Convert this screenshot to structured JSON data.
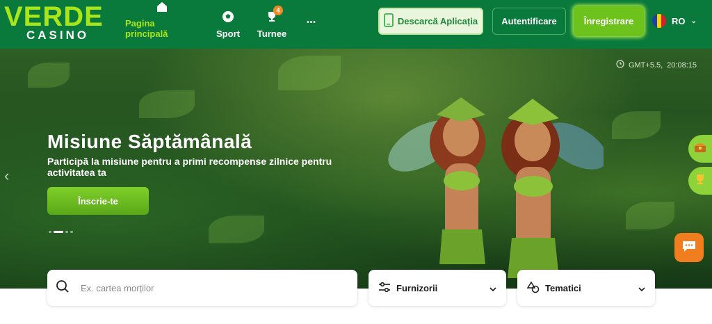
{
  "brand": {
    "logo_top": "VERDE",
    "logo_bottom": "CASINO",
    "accent": "#a8e61a",
    "header_bg": "#0a7a3c",
    "cta_green": "#6ec21c",
    "chat_orange": "#f07d1e"
  },
  "nav": [
    {
      "label": "Pagina principală",
      "icon": "home-icon",
      "active": true
    },
    {
      "label": "Sport",
      "icon": "soccer-ball-icon"
    },
    {
      "label": "Turnee",
      "icon": "trophy-icon",
      "badge": "4"
    },
    {
      "label": "•••",
      "icon": "more-icon"
    }
  ],
  "header_actions": {
    "app_label": "Descarcă Aplicația",
    "login_label": "Autentificare",
    "register_label": "Înregistrare",
    "language": "RO"
  },
  "hero": {
    "timezone": "GMT+5.5,",
    "time": "20:08:15",
    "title": "Misiune Săptămânală",
    "subtitle": "Participă la misiune pentru a primi recompense zilnice pentru activitatea ta",
    "cta_label": "Înscrie-te",
    "slides_total": 4,
    "active_slide": 2
  },
  "search": {
    "placeholder": "Ex. cartea morților"
  },
  "filters": {
    "providers_label": "Furnizorii",
    "themes_label": "Tematici"
  }
}
